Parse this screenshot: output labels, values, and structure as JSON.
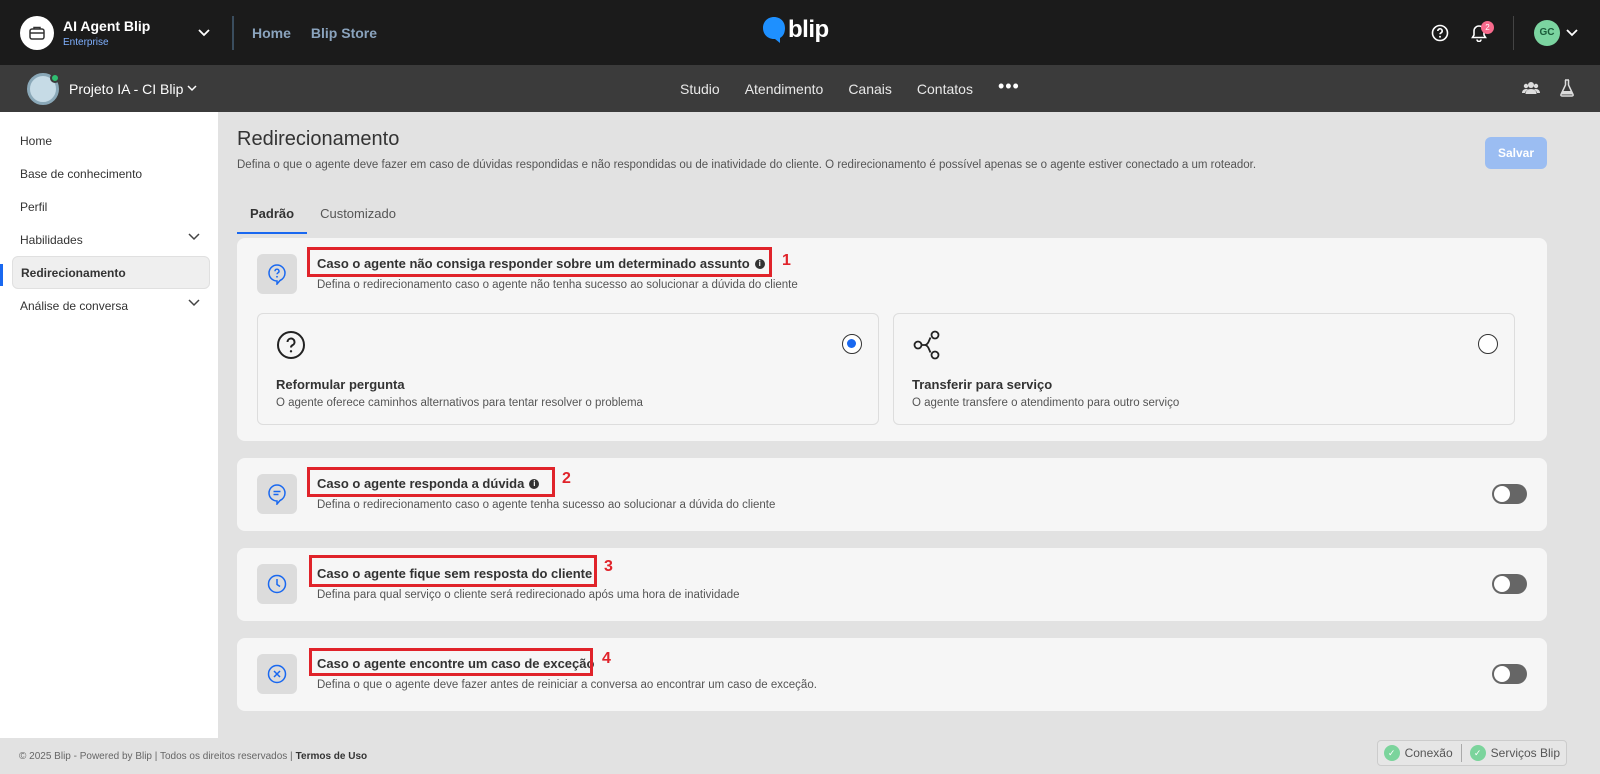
{
  "topbar": {
    "org_name": "AI Agent Blip",
    "org_plan": "Enterprise",
    "links": [
      "Home",
      "Blip Store"
    ],
    "brand": "blip",
    "notification_count": "2",
    "avatar_initials": "GC"
  },
  "subbar": {
    "project_name": "Projeto IA - CI Blip",
    "nav": [
      "Studio",
      "Atendimento",
      "Canais",
      "Contatos"
    ],
    "more": "•••"
  },
  "sidebar": {
    "items": [
      {
        "label": "Home"
      },
      {
        "label": "Base de conhecimento"
      },
      {
        "label": "Perfil"
      },
      {
        "label": "Habilidades"
      },
      {
        "label": "Redirecionamento"
      },
      {
        "label": "Análise de conversa"
      }
    ]
  },
  "main": {
    "title": "Redirecionamento",
    "description": "Defina o que o agente deve fazer em caso de dúvidas respondidas e não respondidas ou de inatividade do cliente. O redirecionamento é possível apenas se o agente estiver conectado a um roteador.",
    "save_label": "Salvar",
    "tabs": [
      "Padrão",
      "Customizado"
    ],
    "cards": [
      {
        "title": "Caso o agente não consiga responder sobre um determinado assunto",
        "description": "Defina o redirecionamento caso o agente não tenha sucesso ao solucionar a dúvida do cliente",
        "marker": "1",
        "options": [
          {
            "title": "Reformular pergunta",
            "description": "O agente oferece caminhos alternativos para tentar resolver o problema",
            "selected": true
          },
          {
            "title": "Transferir para serviço",
            "description": "O agente transfere o atendimento para outro serviço",
            "selected": false
          }
        ]
      },
      {
        "title": "Caso o agente responda a dúvida",
        "description": "Defina o redirecionamento caso o agente tenha sucesso ao solucionar a dúvida do cliente",
        "marker": "2",
        "enabled": false
      },
      {
        "title": "Caso o agente fique sem resposta do cliente",
        "description": "Defina para qual serviço o cliente será redirecionado após uma hora de inatividade",
        "marker": "3",
        "enabled": false
      },
      {
        "title": "Caso o agente encontre um caso de exceção",
        "description": "Defina o que o agente deve fazer antes de reiniciar a conversa ao encontrar um caso de exceção.",
        "marker": "4",
        "enabled": false
      }
    ]
  },
  "footer": {
    "copyright": "© 2025 Blip - Powered by Blip | Todos os direitos reservados |",
    "terms": "Termos de Uso",
    "status": [
      "Conexão",
      "Serviços Blip"
    ]
  },
  "colors": {
    "accent": "#1968f0",
    "highlight_red": "#e0232a",
    "topbar_bg": "#1b1b1b",
    "subbar_bg": "#3b3b3b"
  }
}
